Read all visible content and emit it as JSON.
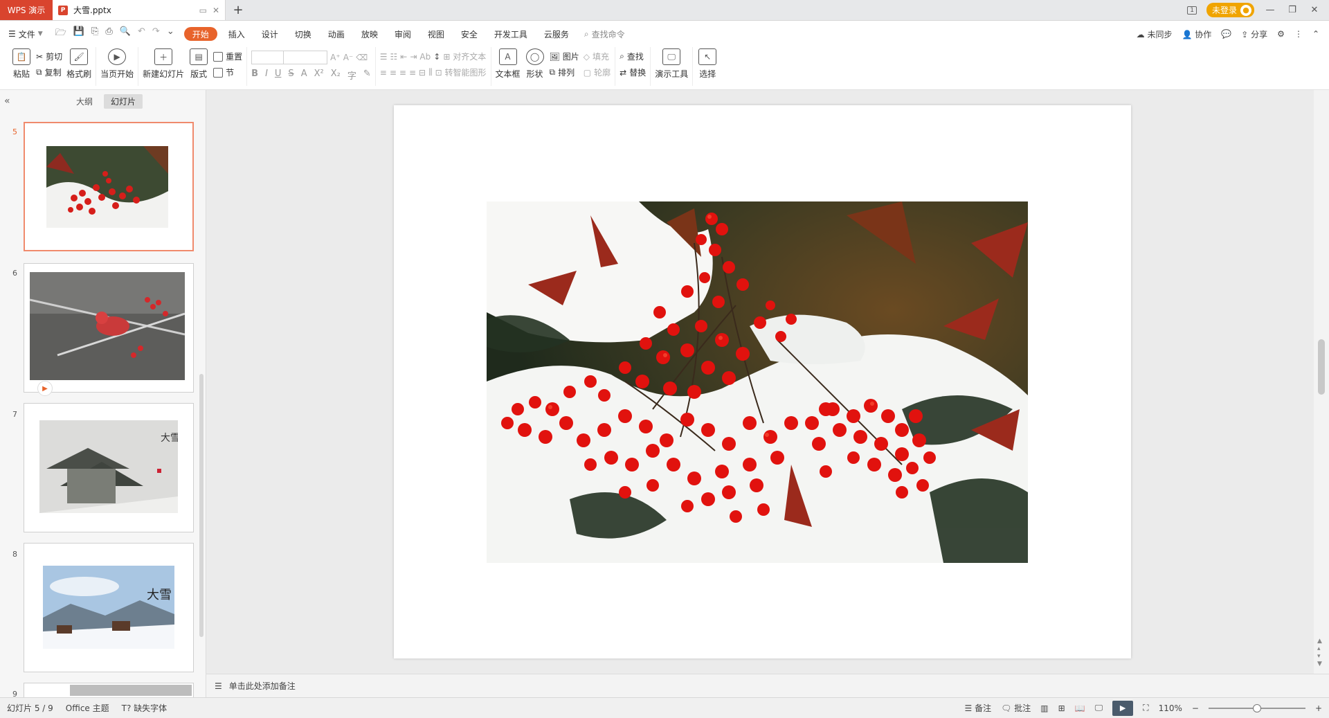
{
  "titlebar": {
    "app_tab": "WPS 演示",
    "doc_tab": "大雪.pptx",
    "login": "未登录",
    "new_tab": "+"
  },
  "menu": {
    "file": "文件",
    "tabs": [
      "开始",
      "插入",
      "设计",
      "切换",
      "动画",
      "放映",
      "审阅",
      "视图",
      "安全",
      "开发工具",
      "云服务"
    ],
    "search": "查找命令",
    "right": [
      "未同步",
      "协作",
      "分享"
    ]
  },
  "ribbon": {
    "paste": "粘贴",
    "cut": "剪切",
    "copy": "复制",
    "format_painter": "格式刷",
    "play_from_current": "当页开始",
    "new_slide": "新建幻灯片",
    "layout": "版式",
    "reset": "重置",
    "section": "节",
    "align_text": "对齐文本",
    "smart_art": "转智能图形",
    "text_box": "文本框",
    "shape": "形状",
    "picture": "图片",
    "arrange": "排列",
    "fill": "填充",
    "outline": "轮廓",
    "find": "查找",
    "replace": "替换",
    "presenter_tools": "演示工具",
    "select": "选择"
  },
  "left_panel": {
    "outline_tab": "大纲",
    "slides_tab": "幻灯片",
    "slides": [
      {
        "num": "5",
        "selected": true
      },
      {
        "num": "6",
        "selected": false
      },
      {
        "num": "7",
        "selected": false,
        "title": "大雪"
      },
      {
        "num": "8",
        "selected": false,
        "title": "大雪"
      },
      {
        "num": "9",
        "selected": false
      }
    ]
  },
  "notes": {
    "placeholder": "单击此处添加备注"
  },
  "status": {
    "slide_info": "幻灯片 5 / 9",
    "theme": "Office 主题",
    "missing_font": "缺失字体",
    "notes": "备注",
    "comments": "批注",
    "zoom": "110%",
    "zoom_fraction": 0.5
  },
  "colors": {
    "accent": "#e8632b",
    "app_red": "#d9442e",
    "login_orange": "#f0a400"
  }
}
